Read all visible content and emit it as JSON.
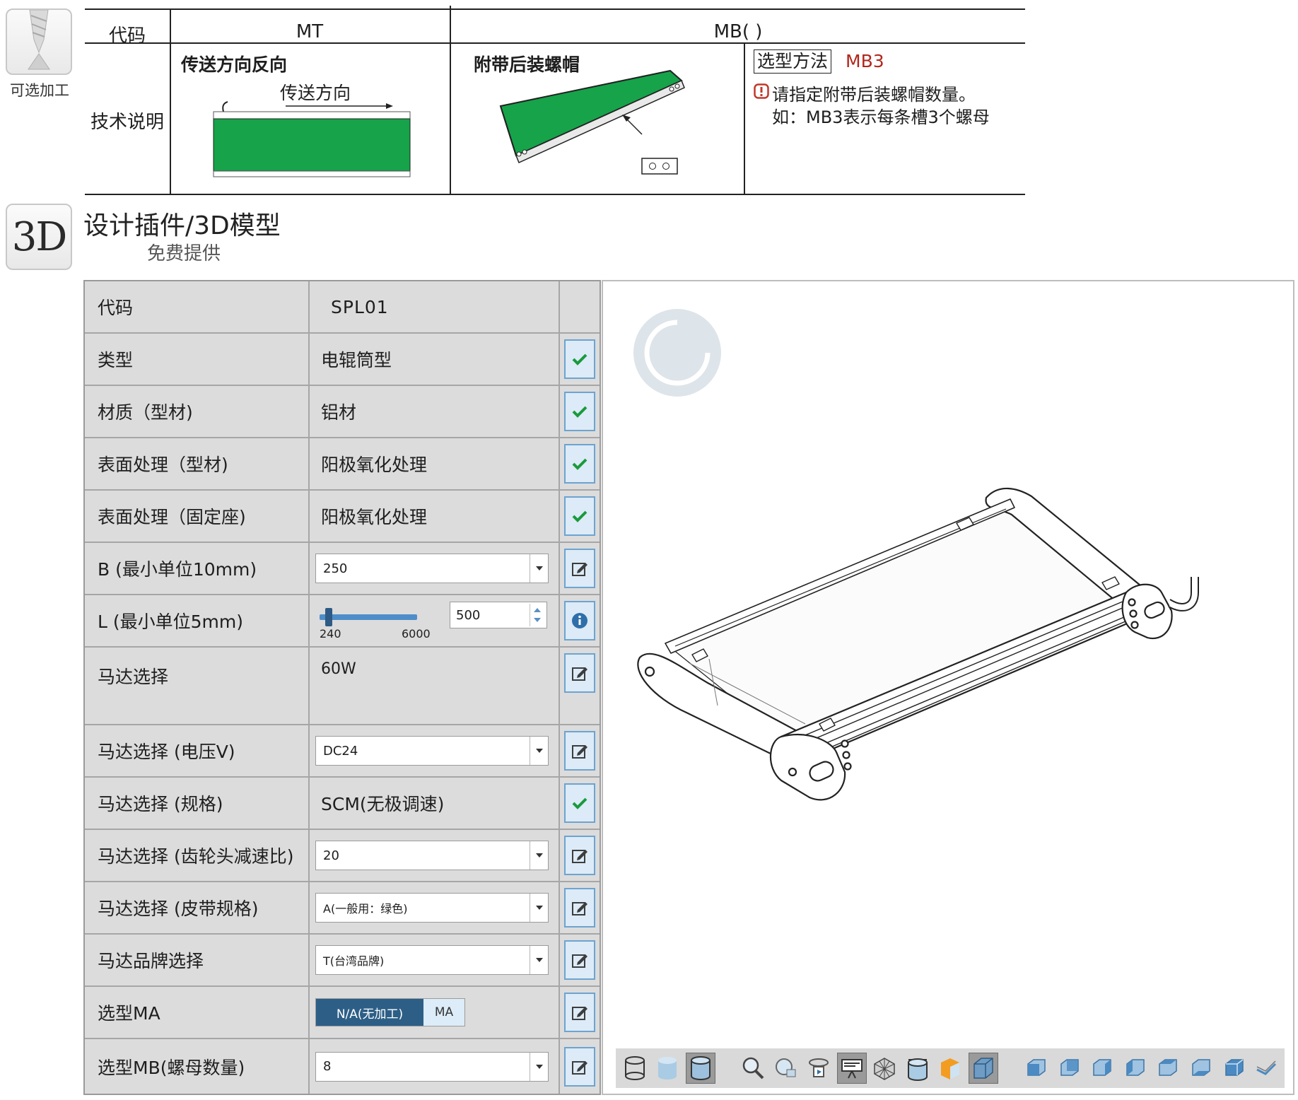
{
  "option_table": {
    "side_badge_caption": "可选加工",
    "head_code_label": "代码",
    "head_mt": "MT",
    "head_mb": "MB( )",
    "tech_label": "技术说明",
    "mt_title": "传送方向反向",
    "mt_arrow_caption": "传送方向",
    "mb_title": "附带后装螺帽",
    "select_method_label": "选型方法",
    "select_method_value": "MB3",
    "note_line1": "请指定附带后装螺帽数量。",
    "note_line2": "如：MB3表示每条槽3个螺母",
    "colors": {
      "belt_green": "#16a34a",
      "method_red": "#b2271c"
    }
  },
  "section": {
    "badge": "3D",
    "title": "设计插件/3D模型",
    "subtitle": "免费提供"
  },
  "config": {
    "header": {
      "label": "代码",
      "value": "SPL01"
    },
    "rows": [
      {
        "label": "类型",
        "value": "电辊筒型",
        "icon": "check-icon"
      },
      {
        "label": "材质（型材)",
        "value": "铝材",
        "icon": "check-icon"
      },
      {
        "label": "表面处理（型材)",
        "value": "阳极氧化处理",
        "icon": "check-icon"
      },
      {
        "label": "表面处理（固定座)",
        "value": "阳极氧化处理",
        "icon": "check-icon"
      },
      {
        "label": "B (最小单位10mm)",
        "select": "250",
        "icon": "edit-icon"
      },
      {
        "label": "L (最小单位5mm)",
        "slider_min": "240",
        "slider_max": "6000",
        "slider_value": "500",
        "icon": "info-icon"
      },
      {
        "label": "马达选择",
        "value": "60W",
        "icon": "edit-icon"
      },
      {
        "label": "马达选择 (电压V)",
        "select": "DC24",
        "icon": "edit-icon"
      },
      {
        "label": "马达选择 (规格)",
        "value": "SCM(无极调速)",
        "icon": "check-icon"
      },
      {
        "label": "马达选择 (齿轮头减速比)",
        "select": "20",
        "icon": "edit-icon"
      },
      {
        "label": "马达选择 (皮带规格)",
        "select": "A(一般用：绿色)",
        "icon": "edit-icon"
      },
      {
        "label": "马达品牌选择",
        "select": "T(台湾品牌)",
        "icon": "edit-icon"
      },
      {
        "label": "选型MA",
        "toggle_on": "N/A(无加工)",
        "toggle_off": "MA",
        "icon": "edit-icon"
      },
      {
        "label": "选型MB(螺母数量)",
        "select": "8",
        "icon": "edit-icon"
      }
    ],
    "colors": {
      "check_green": "#1a9a3c",
      "icon_bg": "#dcebf7",
      "toggle_active": "#2d5f86"
    }
  },
  "viewer": {
    "toolbar_icons": [
      "cylinder-wire-icon",
      "cylinder-solid-icon",
      "cylinder-shaded-icon",
      "zoom-icon",
      "zoom-window-icon",
      "rotate-icon",
      "presentation-icon",
      "mesh-icon",
      "hidden-lines-icon",
      "orange-cube-icon",
      "section-cube-icon",
      "view-front-icon",
      "view-back-icon",
      "view-left-icon",
      "view-right-icon",
      "view-top-icon",
      "view-bottom-icon",
      "view-iso-icon",
      "measure-icon"
    ]
  }
}
